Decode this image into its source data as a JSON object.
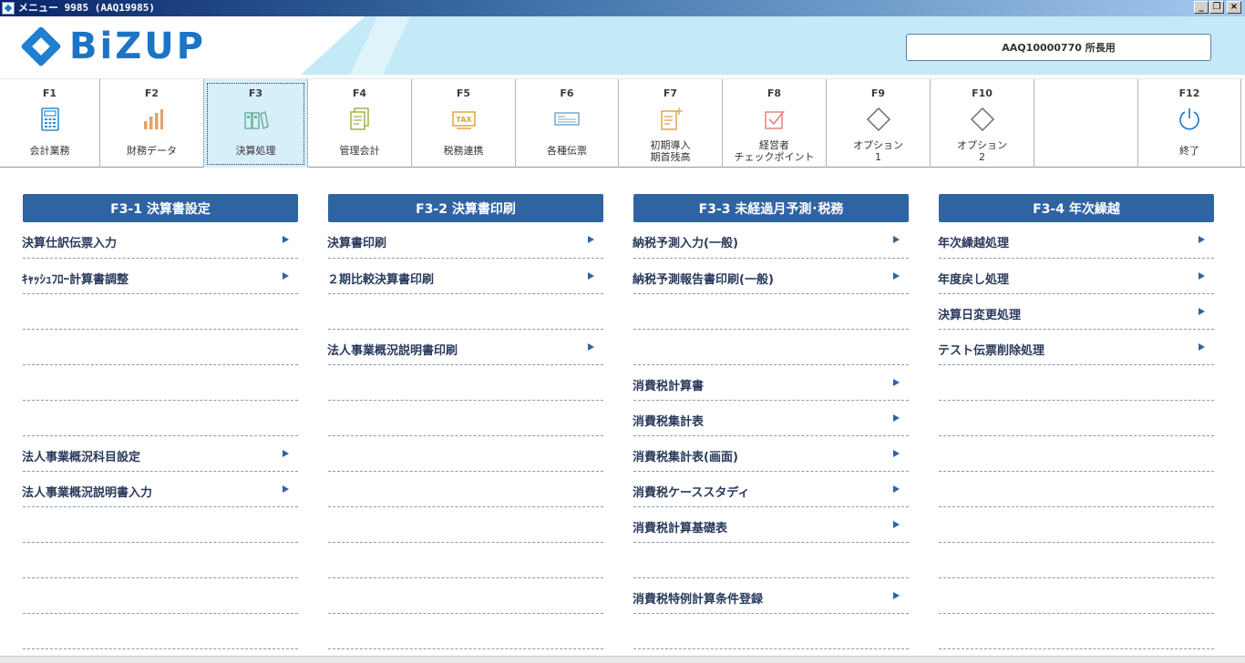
{
  "window": {
    "title": "メニュー 9985 (AAQ19985)",
    "buttons": {
      "minimize": "_",
      "restore": "❐",
      "close": "×"
    }
  },
  "header": {
    "logo_text": "BiZUP",
    "user": "AAQ10000770 所長用"
  },
  "toolbar": {
    "keys": [
      {
        "key": "F1",
        "label": "会計業務",
        "icon": "calculator-icon"
      },
      {
        "key": "F2",
        "label": "財務データ",
        "icon": "bar-chart-icon"
      },
      {
        "key": "F3",
        "label": "決算処理",
        "icon": "binders-icon",
        "active": true
      },
      {
        "key": "F4",
        "label": "管理会計",
        "icon": "documents-icon"
      },
      {
        "key": "F5",
        "label": "税務連携",
        "icon": "tax-icon"
      },
      {
        "key": "F6",
        "label": "各種伝票",
        "icon": "slip-icon"
      },
      {
        "key": "F7",
        "label": "初期導入\n期首残高",
        "icon": "document-plus-icon"
      },
      {
        "key": "F8",
        "label": "経営者\nチェックポイント",
        "icon": "checkbox-icon"
      },
      {
        "key": "F9",
        "label": "オプション\n1",
        "icon": "diamond-icon"
      },
      {
        "key": "F10",
        "label": "オプション\n2",
        "icon": "diamond-icon"
      },
      {
        "key": "",
        "label": "",
        "icon": ""
      },
      {
        "key": "F12",
        "label": "終了",
        "icon": "power-icon"
      }
    ],
    "colors": {
      "accent": "#2f64a3",
      "active_bg": "#d7eefb"
    }
  },
  "columns": [
    {
      "title": "F3-1 決算書設定",
      "items": [
        "決算仕訳伝票入力",
        "ｷｬｯｼｭﾌﾛｰ計算書調整",
        "",
        "",
        "",
        "",
        "法人事業概況科目設定",
        "法人事業概況説明書入力",
        "",
        "",
        "",
        ""
      ]
    },
    {
      "title": "F3-2 決算書印刷",
      "items": [
        "決算書印刷",
        "２期比較決算書印刷",
        "",
        "法人事業概況説明書印刷",
        "",
        "",
        "",
        "",
        "",
        "",
        "",
        ""
      ]
    },
    {
      "title": "F3-3 未経過月予測･税務",
      "items": [
        "納税予測入力(一般)",
        "納税予測報告書印刷(一般)",
        "",
        "",
        "消費税計算書",
        "消費税集計表",
        "消費税集計表(画面)",
        "消費税ケーススタディ",
        "消費税計算基礎表",
        "",
        "消費税特例計算条件登録",
        ""
      ]
    },
    {
      "title": "F3-4 年次繰越",
      "items": [
        "年次繰越処理",
        "年度戻し処理",
        "決算日変更処理",
        "テスト伝票削除処理",
        "",
        "",
        "",
        "",
        "",
        "",
        "",
        ""
      ]
    }
  ]
}
